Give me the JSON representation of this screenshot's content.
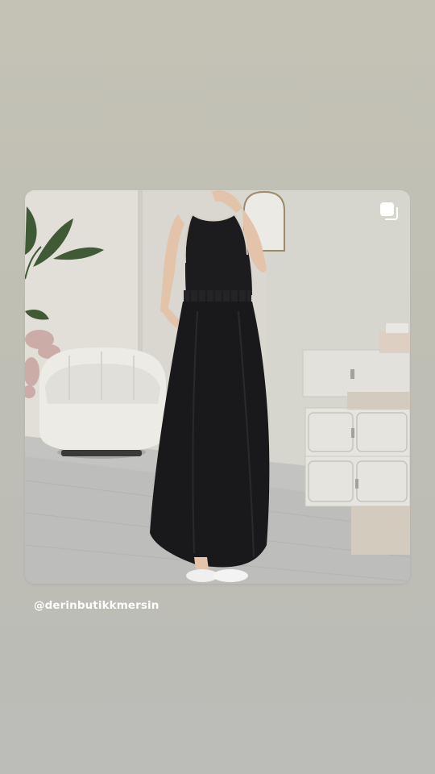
{
  "story": {
    "background_top": "#c4c2b5",
    "background_bottom": "#bcbcb8"
  },
  "post": {
    "username": "@derinbutikkmersin",
    "multi_photo_icon": "carousel-icon",
    "photo_description_colors": {
      "wall": "#d8d6cd",
      "floor": "#bdbdbb",
      "dress": "#1a1a1c",
      "chair": "#ecebe6",
      "cabinet": "#e2e0da"
    }
  }
}
